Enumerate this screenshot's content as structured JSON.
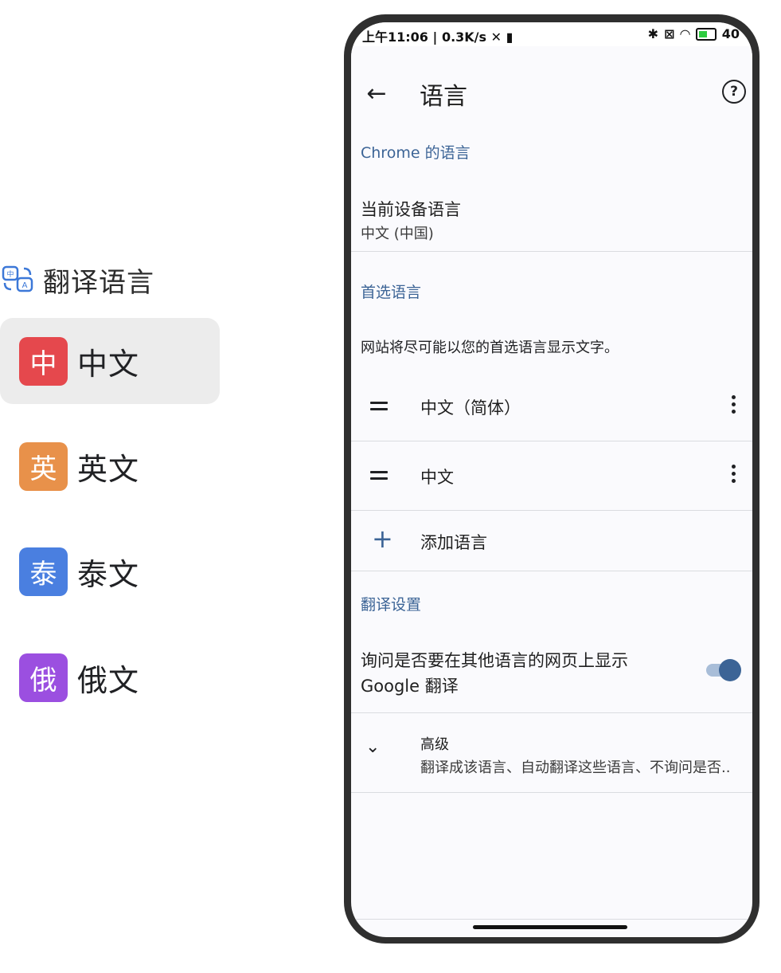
{
  "left": {
    "title": "翻译语言",
    "languages": [
      {
        "badge": "中",
        "name": "中文",
        "color": "#e5484d",
        "selected": true
      },
      {
        "badge": "英",
        "name": "英文",
        "color": "#e8914a",
        "selected": false
      },
      {
        "badge": "泰",
        "name": "泰文",
        "color": "#4a7fe0",
        "selected": false
      },
      {
        "badge": "俄",
        "name": "俄文",
        "color": "#9b4fe0",
        "selected": false
      }
    ]
  },
  "status": {
    "time": "上午11:06",
    "speed": "0.3K/s",
    "battery": "40"
  },
  "appbar": {
    "title": "语言",
    "help": "?"
  },
  "chrome_section": {
    "header": "Chrome 的语言",
    "device_title": "当前设备语言",
    "device_value": "中文 (中国)"
  },
  "preferred_section": {
    "header": "首选语言",
    "description": "网站将尽可能以您的首选语言显示文字。",
    "languages": [
      "中文（简体）",
      "中文"
    ],
    "add_label": "添加语言"
  },
  "translate_section": {
    "header": "翻译设置",
    "ask_line1": "询问是否要在其他语言的网页上显示",
    "ask_line2": "Google 翻译",
    "toggle_on": true
  },
  "advanced": {
    "title": "高级",
    "subtitle": "翻译成该语言、自动翻译这些语言、不询问是否.."
  },
  "colors": {
    "accent": "#3c6496",
    "toggle_track": "#a8bdd8"
  }
}
